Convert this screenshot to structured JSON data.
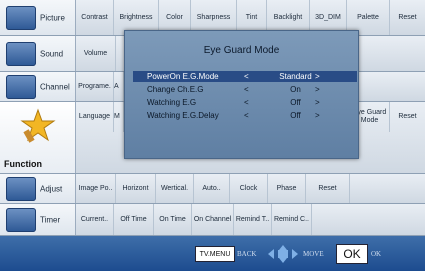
{
  "rows": {
    "picture": {
      "label": "Picture",
      "icon": "picture-icon",
      "items": [
        "Contrast",
        "Brightness",
        "Color",
        "Sharpness",
        "Tint",
        "Backlight",
        "3D_DIM",
        "Palette",
        "Reset"
      ]
    },
    "sound": {
      "label": "Sound",
      "icon": "speaker-icon",
      "items": [
        "Volume"
      ]
    },
    "channel": {
      "label": "Channel",
      "icon": "channel-icon",
      "items": [
        "Programe.",
        "A"
      ]
    },
    "function": {
      "label": "Function",
      "icon": "star-icon",
      "items": [
        "Language",
        "M"
      ],
      "right_items": [
        "Eye Guard Mode",
        "Reset"
      ]
    },
    "adjust": {
      "label": "Adjust",
      "icon": "adjust-icon",
      "items": [
        "Image Po..",
        "Horizont",
        "Wertical.",
        "Auto..",
        "Clock",
        "Phase",
        "Reset"
      ]
    },
    "timer": {
      "label": "Timer",
      "icon": "clock-icon",
      "items": [
        "Current..",
        "Off Time",
        "On Time",
        "On Channel",
        "Remind T..",
        "Remind C.."
      ]
    }
  },
  "dialog": {
    "title": "Eye Guard Mode",
    "options": [
      {
        "name": "PowerOn E.G.Mode",
        "left": "<",
        "value": "Standard",
        "right": ">",
        "selected": true
      },
      {
        "name": "Change Ch.E.G",
        "left": "<",
        "value": "On",
        "right": ">",
        "selected": false
      },
      {
        "name": "Watching E.G",
        "left": "<",
        "value": "Off",
        "right": ">",
        "selected": false
      },
      {
        "name": "Watching E.G.Delay",
        "left": "<",
        "value": "Off",
        "right": ">",
        "selected": false
      }
    ]
  },
  "bottom": {
    "menu": "TV.MENU",
    "back": "BACK",
    "move": "MOVE",
    "ok": "OK",
    "ok_hint": "OK"
  },
  "colors": {
    "selection": "#294c86",
    "bottom_bar": "#1d4c8f",
    "dialog": "#6f8db0"
  }
}
